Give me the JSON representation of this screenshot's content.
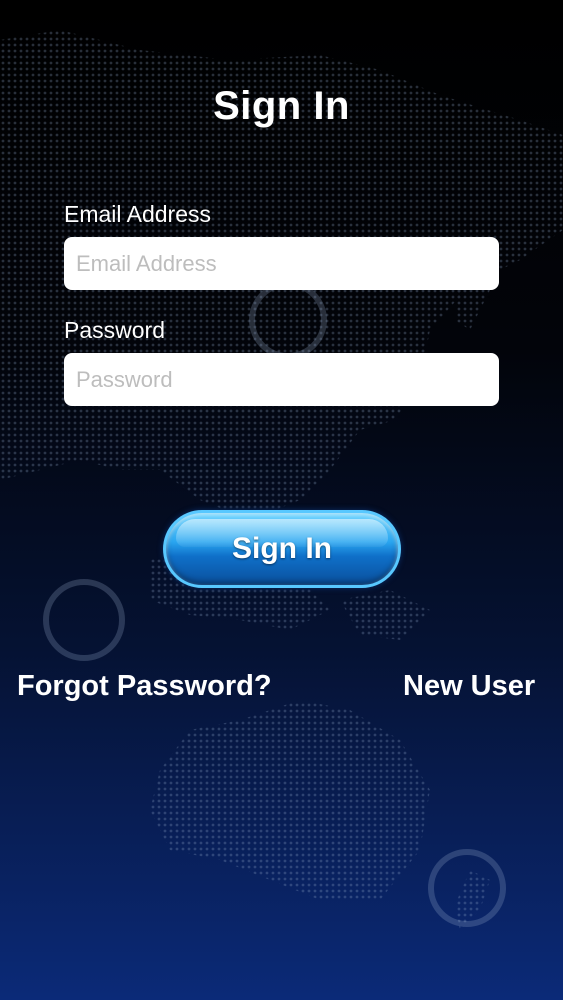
{
  "header": {
    "title": "Sign In"
  },
  "form": {
    "email": {
      "label": "Email Address",
      "placeholder": "Email Address",
      "value": ""
    },
    "password": {
      "label": "Password",
      "placeholder": "Password",
      "value": ""
    },
    "submit_label": "Sign In"
  },
  "links": {
    "forgot_password": "Forgot Password?",
    "new_user": "New User"
  },
  "colors": {
    "background_top": "#000000",
    "background_bottom": "#0b2a78",
    "button_accent": "#2aa6f0",
    "text": "#ffffff"
  }
}
